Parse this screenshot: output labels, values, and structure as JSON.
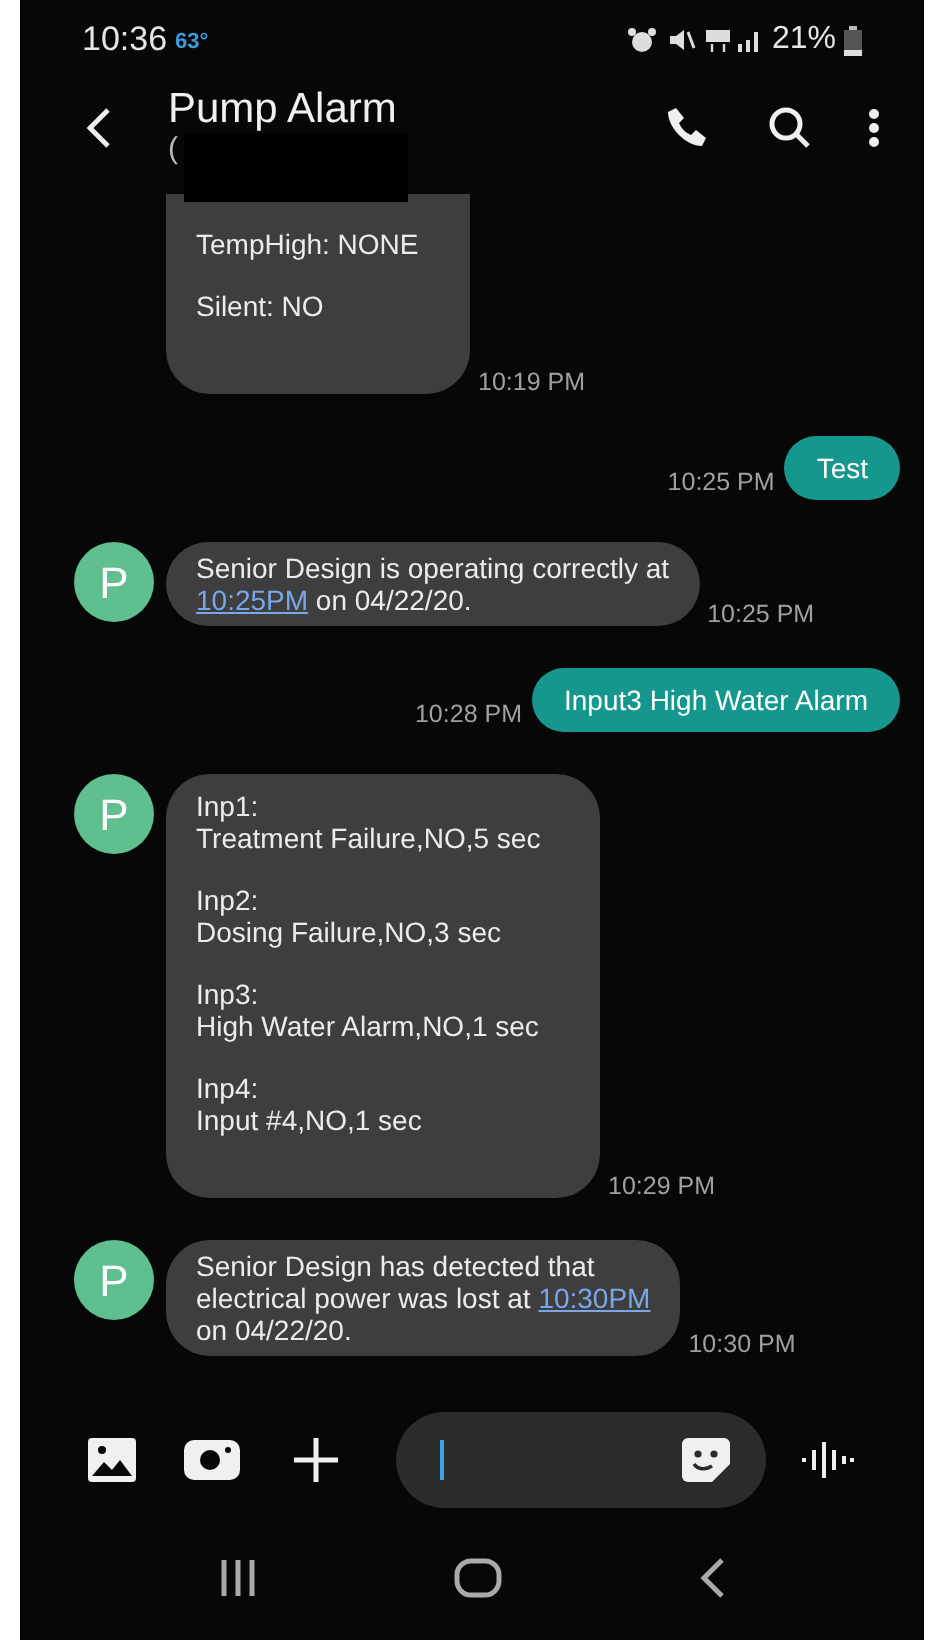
{
  "status_bar": {
    "time": "10:36",
    "temperature": "63°",
    "battery": "21%"
  },
  "header": {
    "title": "Pump Alarm",
    "subtitle": "("
  },
  "messages": [
    {
      "kind": "incoming",
      "cut_top": true,
      "paragraphs": [
        [
          {
            "text": "TempHigh: NONE",
            "link": false
          }
        ],
        [
          {
            "text": "Silent: NO",
            "link": false
          }
        ]
      ],
      "time": "10:19 PM"
    },
    {
      "kind": "outgoing",
      "paragraphs": [
        [
          {
            "text": "Test",
            "link": false
          }
        ]
      ],
      "time": "10:25 PM"
    },
    {
      "kind": "incoming",
      "avatar": "P",
      "paragraphs": [
        [
          {
            "text": "Senior Design is operating correctly at\n",
            "link": false
          },
          {
            "text": "10:25PM",
            "link": true
          },
          {
            "text": " on 04/22/20.",
            "link": false
          }
        ]
      ],
      "time": "10:25 PM"
    },
    {
      "kind": "outgoing",
      "paragraphs": [
        [
          {
            "text": "Input3 High Water Alarm",
            "link": false
          }
        ]
      ],
      "time": "10:28 PM"
    },
    {
      "kind": "incoming",
      "avatar": "P",
      "paragraphs": [
        [
          {
            "text": "Inp1:\nTreatment Failure,NO,5 sec",
            "link": false
          }
        ],
        [
          {
            "text": "Inp2:\nDosing Failure,NO,3 sec",
            "link": false
          }
        ],
        [
          {
            "text": "Inp3:\nHigh Water Alarm,NO,1 sec",
            "link": false
          }
        ],
        [
          {
            "text": "Inp4:\nInput #4,NO,1 sec",
            "link": false
          }
        ]
      ],
      "time": "10:29 PM"
    },
    {
      "kind": "incoming",
      "avatar": "P",
      "paragraphs": [
        [
          {
            "text": "Senior Design has detected that\nelectrical power was lost at ",
            "link": false
          },
          {
            "text": "10:30PM",
            "link": true
          },
          {
            "text": "\non 04/22/20.",
            "link": false
          }
        ]
      ],
      "time": "10:30 PM"
    }
  ]
}
